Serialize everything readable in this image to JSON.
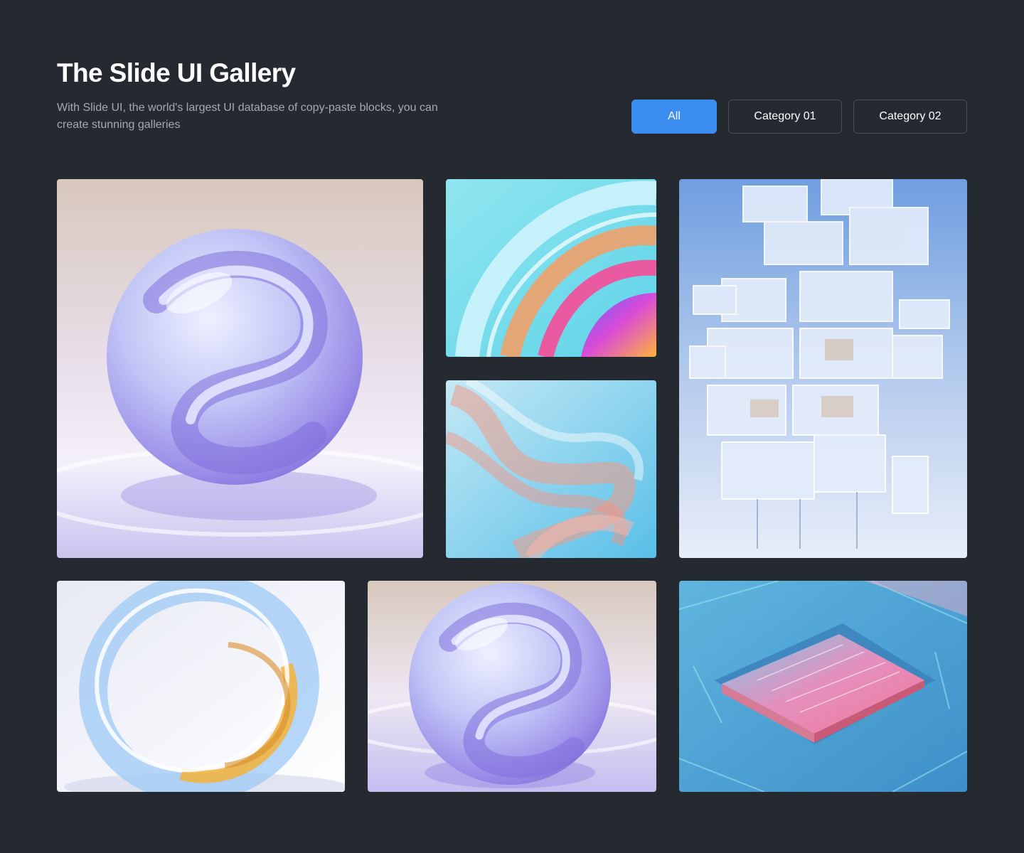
{
  "header": {
    "title": "The Slide UI Gallery",
    "subtitle": "With Slide UI, the world's largest UI database of copy-paste blocks, you can create stunning galleries"
  },
  "filters": [
    {
      "label": "All",
      "active": true
    },
    {
      "label": "Category 01",
      "active": false
    },
    {
      "label": "Category 02",
      "active": false
    }
  ],
  "colors": {
    "background": "#252a30",
    "accent": "#3b8ef0",
    "subtitle_text": "#a3a9b2",
    "button_border": "#474d55"
  },
  "gallery": {
    "images": [
      {
        "subject": "glass-sphere-lavender"
      },
      {
        "subject": "iridescent-glass-swirl"
      },
      {
        "subject": "translucent-ribbon-waves"
      },
      {
        "subject": "glass-cube-tower"
      },
      {
        "subject": "glass-ring-gold"
      },
      {
        "subject": "glass-sphere-lavender"
      },
      {
        "subject": "microchip-neon"
      }
    ]
  }
}
